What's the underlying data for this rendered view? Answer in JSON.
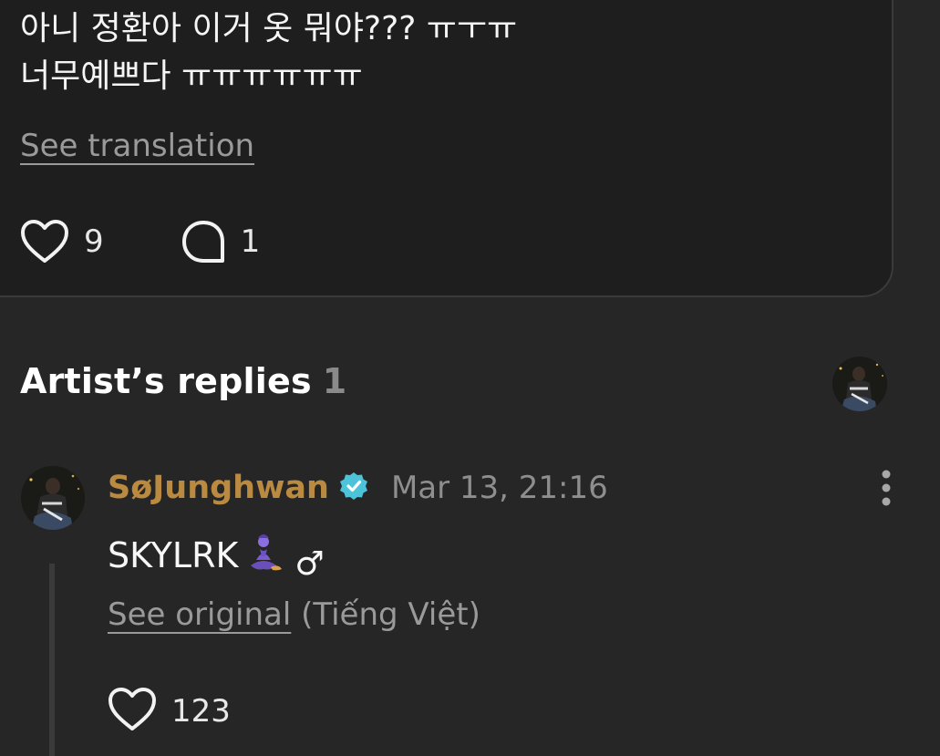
{
  "post": {
    "text": "아니 정환아 이거 옷 뭐야??? ㅠㅜㅠ\n너무예쁘다 ㅠㅠㅠㅠㅠㅠ",
    "see_translation": "See translation",
    "likes": "9",
    "comments": "1"
  },
  "artist_replies": {
    "title": "Artist’s replies",
    "count": "1"
  },
  "reply": {
    "author": "SøJunghwan",
    "date": "Mar 13, 21:16",
    "text": "SKYLRK",
    "emoji": "genie",
    "symbol": "♂",
    "see_original": "See original",
    "language": "(Tiếng Việt)",
    "likes": "123"
  },
  "colors": {
    "background": "#262626",
    "card": "#1e1e1e",
    "author": "#b98a3f",
    "verified": "#4cc3d9",
    "muted": "#8e8e8e"
  },
  "icons": [
    "heart-icon",
    "comment-bubble-icon",
    "verified-badge-icon",
    "more-vertical-icon",
    "genie-emoji-icon"
  ]
}
